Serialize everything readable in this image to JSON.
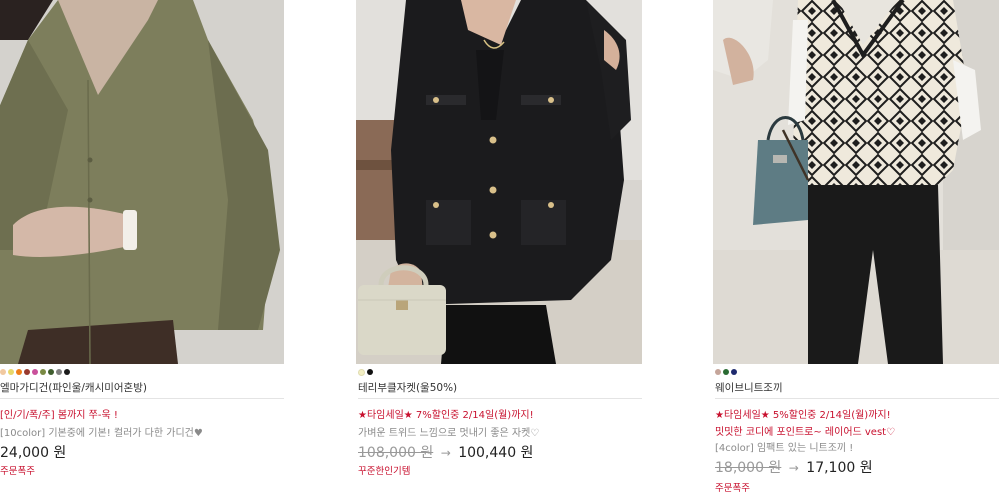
{
  "products": [
    {
      "title": "엘마가디건(파인울/캐시미어혼방)",
      "swatch_colors": [
        "#f1c9a0",
        "#e8d86b",
        "#ef7f1a",
        "#9a3a2f",
        "#c9509b",
        "#7a8a44",
        "#3f5d2e",
        "#808080",
        "#1c1c1c"
      ],
      "promo": "[인/기/폭/주] 봄까지 쭈-욱 !",
      "desc": "[10color] 기본중에 기본! 컬러가 다한 가디건♥",
      "price": "24,000 원",
      "tag": "주문폭주"
    },
    {
      "title": "테리부클자켓(울50%)",
      "swatch_colors": [
        "#f3efc4",
        "#111111"
      ],
      "promo": "★타임세일★ 7%할인중 2/14일(월)까지!",
      "desc": "가벼운 트위드 느낌으로 멋내기 좋은 자켓♡",
      "original_price": "108,000 원",
      "final_price": "100,440 원",
      "tag": "꾸준한인기템"
    },
    {
      "title": "웨이브니트조끼",
      "swatch_colors": [
        "#c5a59a",
        "#2a6b33",
        "#1e2a6e"
      ],
      "promo": "★타임세일★ 5%할인중 2/14일(월)까지!",
      "promo2": "밋밋한 코디에 포인트로~ 레이어드 vest♡",
      "desc": "[4color] 임팩트 있는 니트조끼 !",
      "original_price": "18,000 원",
      "final_price": "17,100 원",
      "tag": "주문폭주"
    }
  ]
}
